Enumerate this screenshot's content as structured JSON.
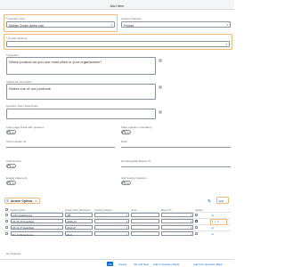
{
  "dialog": {
    "title": "Add Item"
  },
  "fields": {
    "question_type": {
      "label": "Question Type",
      "value": "Multiple Choice (select one)"
    },
    "answer_category": {
      "label": "Answer Category",
      "value": "Product"
    },
    "answer_attribute": {
      "label": "Answer Attribute",
      "value": ""
    },
    "question": {
      "label": "Question",
      "value": "Which product do you use most often in your organisation?"
    },
    "additional_information": {
      "label": "Additional Information",
      "value": "Select one of our products"
    },
    "question_short_description": {
      "label": "Question Short Description",
      "value": ""
    },
    "new_page_break": {
      "label": "Insert page break after question",
      "toggle": "No"
    },
    "make_mandatory": {
      "label": "Make question mandatory",
      "toggle": "No"
    },
    "show_header": {
      "label": "Show Header for",
      "value": ""
    },
    "ratio": {
      "label": "Ratio",
      "value": ""
    },
    "attachments": {
      "label": "Attachments",
      "toggle": "No"
    },
    "list_question": {
      "label": "Exchangeable Branch To",
      "value": ""
    },
    "enable_statement": {
      "label": "Enable statement",
      "toggle": "No"
    },
    "add_source": {
      "label": "Add Source Question",
      "toggle": "No"
    }
  },
  "answer_section": {
    "title": "Answer Options",
    "collapse_label": "Edit",
    "columns": [
      "Answer Option",
      "Answer Short Description",
      "Answer Category",
      "Score",
      "Branch To",
      "Default",
      ""
    ],
    "rows": [
      {
        "option": "H 82 Headphones",
        "short": "H82",
        "category": "",
        "score": "",
        "branch": ""
      },
      {
        "option": "HS 36-43 HeadSets",
        "short": "HS36-43",
        "category": "",
        "score": "",
        "branch": ""
      },
      {
        "option": "HS 11-07 HeadSets",
        "short": "HS11-07",
        "category": "",
        "score": "",
        "branch": ""
      },
      {
        "option": "M 1-6 Microphones",
        "short": "M1-6",
        "category": "",
        "score": "",
        "branch": ""
      }
    ],
    "selected_count": "1 Selected"
  },
  "footer": {
    "buttons": [
      "OK",
      "Cancel",
      "OK and New",
      "Add to Question Bank",
      "Add from Question Bank"
    ]
  },
  "colors": {
    "highlight": "#f0b97e",
    "accent": "#0a6ed1"
  }
}
